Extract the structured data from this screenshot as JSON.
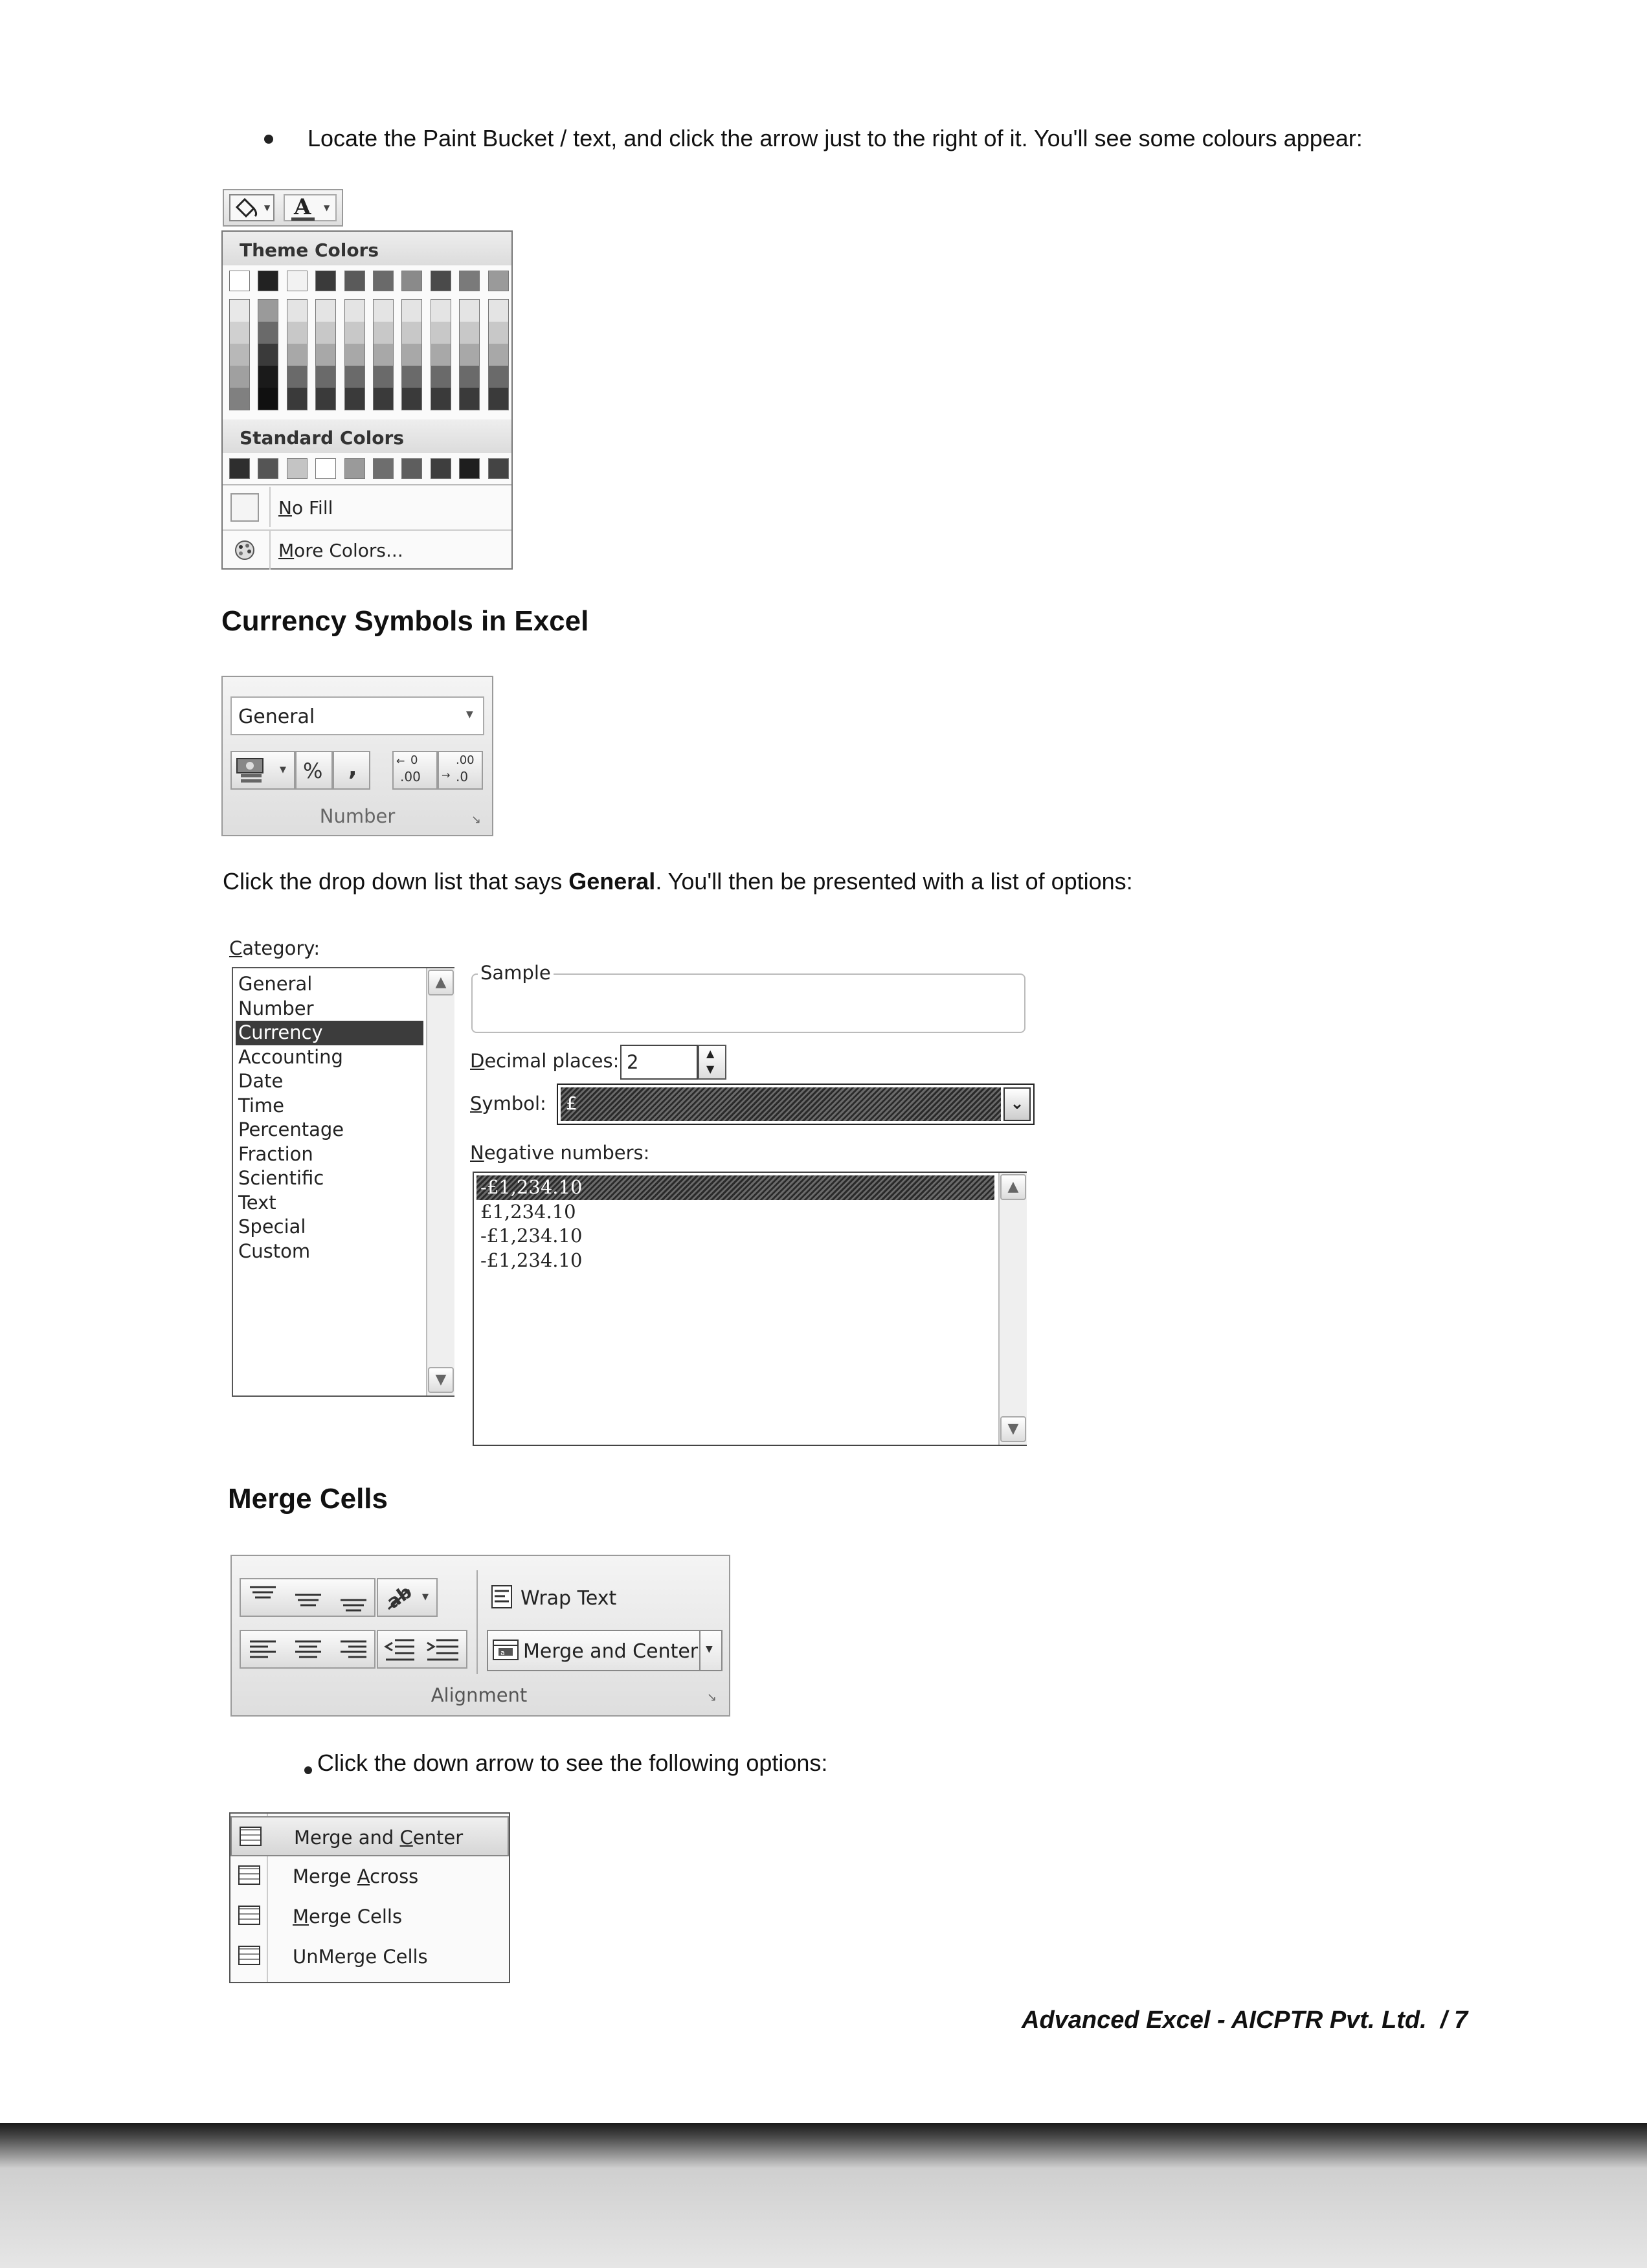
{
  "intro_bullet": "Locate the Paint Bucket / text, and click the arrow just to the right of it. You'll see some colours appear:",
  "color_menu": {
    "toolbar_font_letter": "A",
    "theme_colors_label": "Theme Colors",
    "standard_colors_label": "Standard Colors",
    "no_fill_prefix": "N",
    "no_fill_rest": "o Fill",
    "more_colors_prefix": "M",
    "more_colors_rest": "ore Colors...",
    "theme_top_row": [
      "#ffffff",
      "#222222",
      "#f2f2f2",
      "#3a3a3a",
      "#5a5a5a",
      "#6a6a6a",
      "#8a8a8a",
      "#4a4a4a",
      "#7a7a7a",
      "#9a9a9a"
    ],
    "standard_row": [
      "#2e2e2e",
      "#555555",
      "#c4c4c4",
      "#ffffff",
      "#9a9a9a",
      "#6e6e6e",
      "#5e5e5e",
      "#3e3e3e",
      "#1e1e1e",
      "#444444"
    ]
  },
  "currency_heading": "Currency Symbols in Excel",
  "number_group": {
    "format_value": "General",
    "percent_label": "%",
    "comma_label": ",",
    "increase_decimal_label": ".00",
    "decrease_decimal_label": ".0",
    "group_label": "Number"
  },
  "click_text": {
    "before": "Click the drop down list that says ",
    "bold": "General",
    "after": ". You'll then be presented with a list of options:"
  },
  "format_dialog": {
    "category_label_prefix": "C",
    "category_label_rest": "ategory:",
    "categories": [
      "General",
      "Number",
      "Currency",
      "Accounting",
      "Date",
      "Time",
      "Percentage",
      "Fraction",
      "Scientific",
      "Text",
      "Special",
      "Custom"
    ],
    "selected_category": "Currency",
    "sample_label": "Sample",
    "decimal_label_prefix": "D",
    "decimal_label_rest": "ecimal places:",
    "decimal_value": "2",
    "symbol_label_prefix": "S",
    "symbol_label_rest": "ymbol:",
    "symbol_value": "£",
    "negative_label_prefix": "N",
    "negative_label_rest": "egative numbers:",
    "negative_options": [
      "-£1,234.10",
      "£1,234.10",
      "-£1,234.10",
      "-£1,234.10"
    ]
  },
  "merge_heading": "Merge Cells",
  "alignment_group": {
    "wrap_text": "Wrap Text",
    "merge_center": "Merge and Center",
    "group_label": "Alignment"
  },
  "click_arrow_text": "Click the down arrow to see the following options:",
  "merge_menu": [
    {
      "before": "Merge and ",
      "key": "C",
      "after": "enter"
    },
    {
      "before": "Merge ",
      "key": "A",
      "after": "cross"
    },
    {
      "before": "",
      "key": "M",
      "after": "erge Cells"
    },
    {
      "before": "UnMerge Cells",
      "key": "",
      "after": ""
    }
  ],
  "footer": "Advanced Excel - AICPTR Pvt. Ltd.  / 7"
}
